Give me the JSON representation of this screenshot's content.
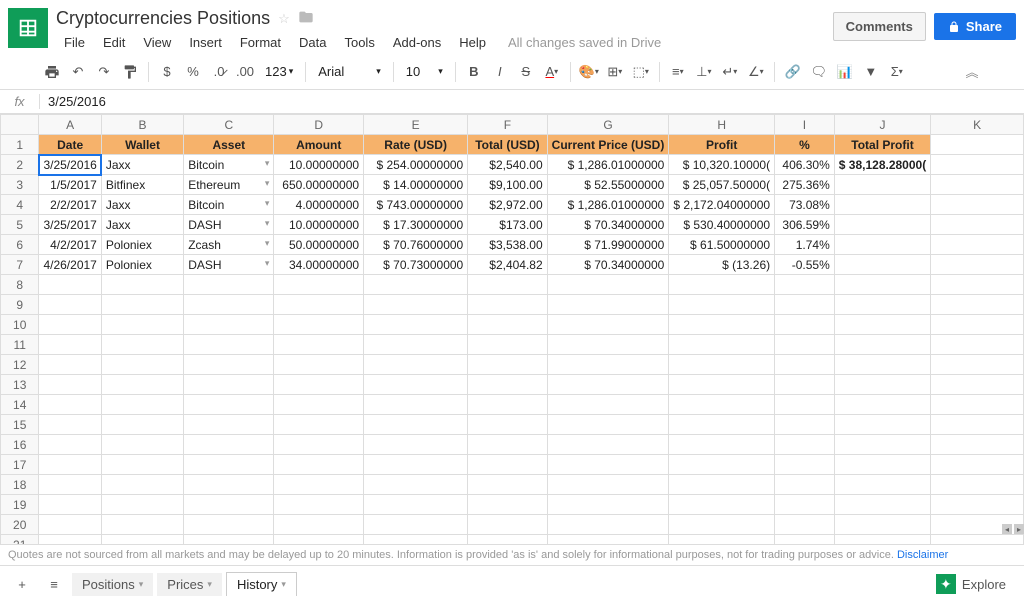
{
  "doc": {
    "title": "Cryptocurrencies Positions"
  },
  "menus": [
    "File",
    "Edit",
    "View",
    "Insert",
    "Format",
    "Data",
    "Tools",
    "Add-ons",
    "Help"
  ],
  "save_status": "All changes saved in Drive",
  "buttons": {
    "comments": "Comments",
    "share": "Share",
    "explore": "Explore"
  },
  "toolbar": {
    "font": "Arial",
    "size": "10",
    "zoom": "123"
  },
  "formula": {
    "value": "3/25/2016"
  },
  "columns": [
    "A",
    "B",
    "C",
    "D",
    "E",
    "F",
    "G",
    "H",
    "I",
    "J",
    "K"
  ],
  "headers": [
    "Date",
    "Wallet",
    "Asset",
    "Amount",
    "Rate (USD)",
    "Total (USD)",
    "Current Price (USD)",
    "Profit",
    "%",
    "Total Profit"
  ],
  "rows": [
    {
      "date": "3/25/2016",
      "wallet": "Jaxx",
      "asset": "Bitcoin",
      "amount": "10.00000000",
      "rate": "$ 254.00000000",
      "total": "$2,540.00",
      "cprice": "$  1,286.01000000",
      "profit": "$ 10,320.10000(",
      "pct": "406.30%",
      "tprofit": "$ 38,128.28000("
    },
    {
      "date": "1/5/2017",
      "wallet": "Bitfinex",
      "asset": "Ethereum",
      "amount": "650.00000000",
      "rate": "$ 14.00000000",
      "total": "$9,100.00",
      "cprice": "$       52.55000000",
      "profit": "$ 25,057.50000(",
      "pct": "275.36%",
      "tprofit": ""
    },
    {
      "date": "2/2/2017",
      "wallet": "Jaxx",
      "asset": "Bitcoin",
      "amount": "4.00000000",
      "rate": "$ 743.00000000",
      "total": "$2,972.00",
      "cprice": "$  1,286.01000000",
      "profit": "$ 2,172.04000000",
      "pct": "73.08%",
      "tprofit": ""
    },
    {
      "date": "3/25/2017",
      "wallet": "Jaxx",
      "asset": "DASH",
      "amount": "10.00000000",
      "rate": "$ 17.30000000",
      "total": "$173.00",
      "cprice": "$       70.34000000",
      "profit": "$ 530.40000000",
      "pct": "306.59%",
      "tprofit": ""
    },
    {
      "date": "4/2/2017",
      "wallet": "Poloniex",
      "asset": "Zcash",
      "amount": "50.00000000",
      "rate": "$ 70.76000000",
      "total": "$3,538.00",
      "cprice": "$       71.99000000",
      "profit": "$ 61.50000000",
      "pct": "1.74%",
      "tprofit": ""
    },
    {
      "date": "4/26/2017",
      "wallet": "Poloniex",
      "asset": "DASH",
      "amount": "34.00000000",
      "rate": "$ 70.73000000",
      "total": "$2,404.82",
      "cprice": "$       70.34000000",
      "profit": "$          (13.26)",
      "pct": "-0.55%",
      "tprofit": ""
    }
  ],
  "disclaimer": "Quotes are not sourced from all markets and may be delayed up to 20 minutes. Information is provided 'as is' and solely for informational purposes, not for trading purposes or advice.",
  "disclaimer_link": "Disclaimer",
  "tabs": [
    {
      "name": "Positions",
      "active": false
    },
    {
      "name": "Prices",
      "active": false
    },
    {
      "name": "History",
      "active": true
    }
  ]
}
